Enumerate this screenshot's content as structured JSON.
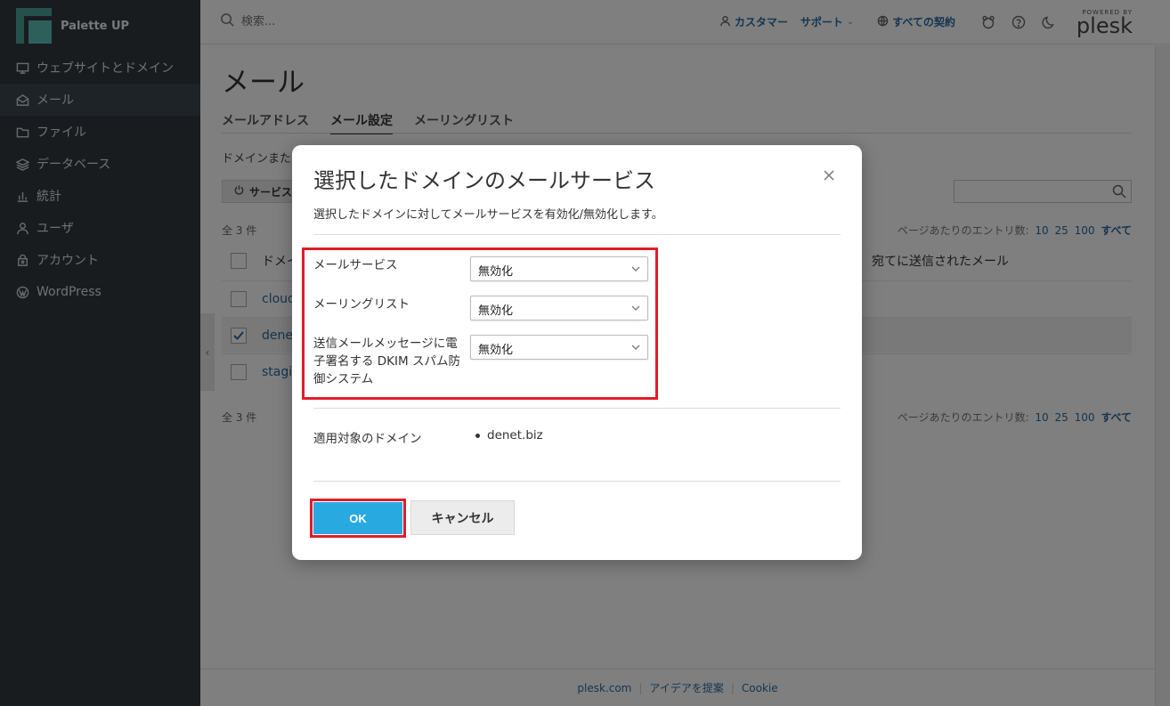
{
  "sidebar": {
    "brand": "Palette UP",
    "items": [
      {
        "label": "ウェブサイトとドメイン",
        "icon": "monitor-icon"
      },
      {
        "label": "メール",
        "icon": "mail-icon"
      },
      {
        "label": "ファイル",
        "icon": "folder-icon"
      },
      {
        "label": "データベース",
        "icon": "database-icon"
      },
      {
        "label": "統計",
        "icon": "bar-chart-icon"
      },
      {
        "label": "ユーザ",
        "icon": "user-icon"
      },
      {
        "label": "アカウント",
        "icon": "account-icon"
      },
      {
        "label": "WordPress",
        "icon": "wordpress-icon"
      }
    ],
    "active_index": 1
  },
  "topbar": {
    "search_placeholder": "検索...",
    "customer": "カスタマー",
    "support": "サポート",
    "subscriptions": "すべての契約",
    "powered_by": "POWERED BY",
    "plesk": "plesk"
  },
  "main": {
    "title": "メール",
    "tabs": [
      "メールアドレス",
      "メール設定",
      "メーリングリスト"
    ],
    "active_tab": 1,
    "desc_text": "ドメインまた",
    "service_button": "サービス",
    "count_top": "全 3 件",
    "count_bottom": "全 3 件",
    "perpage_label": "ページあたりのエントリ数:",
    "perpage_options": [
      "10",
      "25",
      "100",
      "すべて"
    ],
    "column_domain": "ドメイ",
    "column_outgoing": "宛てに送信されたメール",
    "rows": [
      {
        "name": "cloud",
        "checked": false
      },
      {
        "name": "denet",
        "checked": true
      },
      {
        "name": "stagi",
        "checked": false
      }
    ]
  },
  "footer": {
    "links": [
      "plesk.com",
      "アイデアを提案",
      "Cookie"
    ]
  },
  "dialog": {
    "title": "選択したドメインのメールサービス",
    "description": "選択したドメインに対してメールサービスを有効化/無効化します。",
    "fields": [
      {
        "label": "メールサービス",
        "value": "無効化"
      },
      {
        "label": "メーリングリスト",
        "value": "無効化"
      },
      {
        "label": "送信メールメッセージに電子署名する DKIM スパム防御システム",
        "value": "無効化"
      }
    ],
    "applies_label": "適用対象のドメイン",
    "applies_value": "denet.biz",
    "ok": "OK",
    "cancel": "キャンセル"
  },
  "colors": {
    "sidebar_bg": "#30393f",
    "link": "#2a6b9e",
    "ok_button": "#28aae1",
    "highlight": "#e11c2a"
  }
}
